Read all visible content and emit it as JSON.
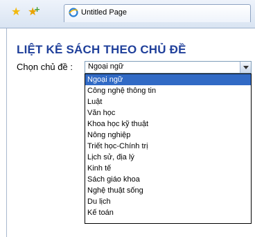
{
  "browser": {
    "tab_title": "Untitled Page"
  },
  "page": {
    "heading": "LIỆT KÊ SÁCH THEO CHỦ ĐỀ",
    "topic_label": "Chọn chủ đề :",
    "selected_topic": "Ngoại ngữ",
    "topics": [
      "Ngoại ngữ",
      "Công nghệ thông tin",
      "Luật",
      "Văn học",
      "Khoa học kỹ thuật",
      "Nông nghiệp",
      "Triết học-Chính trị",
      "Lịch sử, địa lý",
      "Kinh tế",
      "Sách giáo khoa",
      "Nghệ thuật sống",
      "Du lịch",
      "Kế toán"
    ]
  },
  "colors": {
    "heading": "#1f3f9a",
    "selection_bg": "#316ac5",
    "selection_fg": "#ffffff"
  }
}
